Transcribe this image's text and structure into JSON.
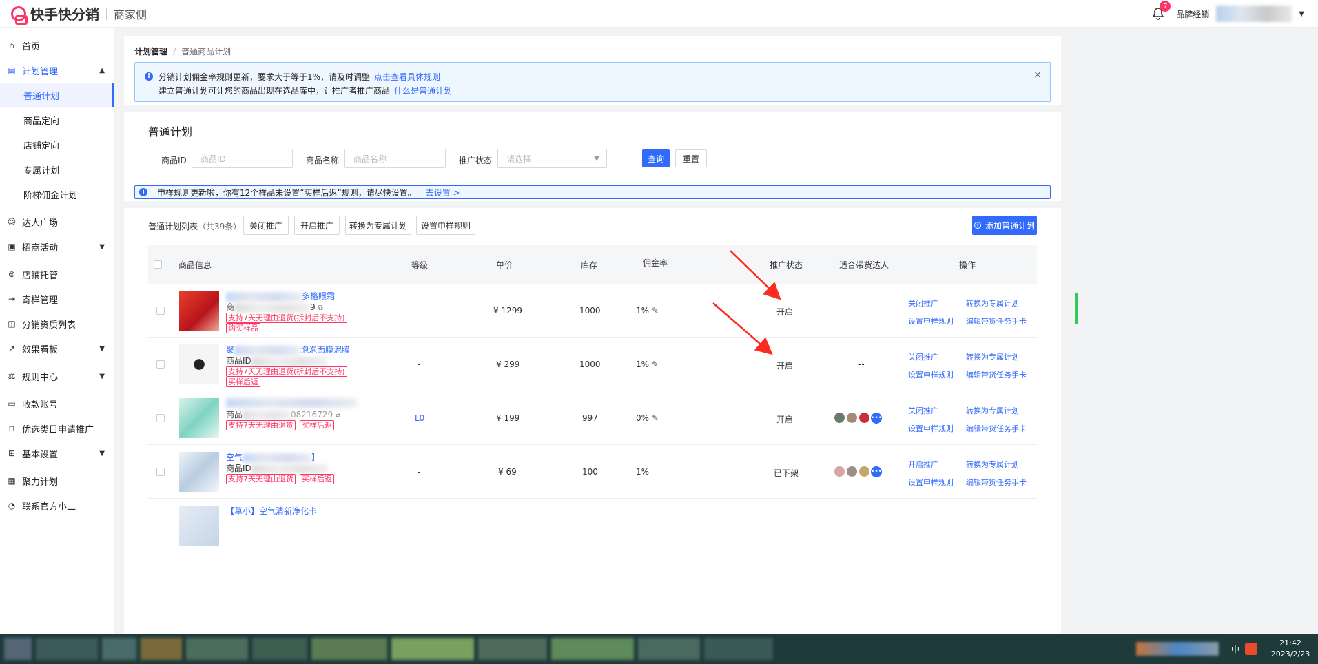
{
  "app": {
    "logo_text": "快手快分销",
    "logo_sub": "商家侧"
  },
  "header": {
    "notification_count": "7",
    "role": "品牌经销"
  },
  "sidebar": {
    "items": [
      {
        "label": "首页",
        "icon": "home-icon"
      },
      {
        "label": "计划管理",
        "icon": "plan-icon",
        "expanded": true,
        "children": [
          {
            "label": "普通计划",
            "active": true
          },
          {
            "label": "商品定向"
          },
          {
            "label": "店铺定向"
          },
          {
            "label": "专属计划"
          },
          {
            "label": "阶梯佣金计划"
          }
        ]
      },
      {
        "label": "达人广场",
        "icon": "person-icon"
      },
      {
        "label": "招商活动",
        "icon": "activity-icon",
        "has_children": true
      },
      {
        "label": "店铺托管",
        "icon": "store-icon"
      },
      {
        "label": "寄样管理",
        "icon": "sample-icon"
      },
      {
        "label": "分销资质列表",
        "icon": "bag-icon"
      },
      {
        "label": "效果看板",
        "icon": "chart-icon",
        "has_children": true
      },
      {
        "label": "规则中心",
        "icon": "rule-icon",
        "has_children": true
      },
      {
        "label": "收款账号",
        "icon": "wallet-icon"
      },
      {
        "label": "优选类目申请推广",
        "icon": "lock-icon"
      },
      {
        "label": "基本设置",
        "icon": "grid-icon",
        "has_children": true
      },
      {
        "label": "聚力计划",
        "icon": "doc-icon"
      },
      {
        "label": "联系官方小二",
        "icon": "chat-icon"
      }
    ]
  },
  "breadcrumb": {
    "root": "计划管理",
    "current": "普通商品计划"
  },
  "notice": {
    "line1": "分销计划佣金率规则更新，要求大于等于1%，请及时调整",
    "line1_link": "点击查看具体规则",
    "line2": "建立普通计划可让您的商品出现在选品库中，让推广者推广商品",
    "line2_link": "什么是普通计划",
    "close": "×"
  },
  "filters": {
    "title": "普通计划",
    "product_id_label": "商品ID",
    "product_id_placeholder": "商品ID",
    "product_name_label": "商品名称",
    "product_name_placeholder": "商品名称",
    "status_label": "推广状态",
    "status_placeholder": "请选择",
    "query_button": "查询",
    "reset_button": "重置"
  },
  "sample_notice": {
    "text": "申样规则更新啦，你有12个样品未设置“买样后返”规则，请尽快设置。",
    "link": "去设置 >"
  },
  "list": {
    "title": "普通计划列表",
    "count": "（共39条）",
    "actions": [
      "关闭推广",
      "开启推广",
      "转换为专属计划",
      "设置申样规则"
    ],
    "add_button": "添加普通计划"
  },
  "table": {
    "headers": {
      "product": "商品信息",
      "level": "等级",
      "price": "单价",
      "stock": "库存",
      "commission": "佣金率",
      "status": "推广状态",
      "talent": "适合带货达人",
      "ops": "操作"
    },
    "rows": [
      {
        "name_suffix": "多格眼霜",
        "id_prefix": "商",
        "id_suffix": "9",
        "tags": [
          "支持7天无理由退货(拆封后不支持)",
          "购买样品"
        ],
        "level": "-",
        "price": "¥ 1299",
        "stock": "1000",
        "commission": "1%",
        "status": "开启",
        "talent": "--",
        "op1": "关闭推广",
        "op2": "转换为专属计划",
        "op3": "设置申样规则",
        "op4": "编辑带货任务手卡"
      },
      {
        "name_prefix": "聚",
        "name_suffix": "泡泡面膜泥膜",
        "id_prefix": "商品ID",
        "id_suffix": "",
        "tags": [
          "支持7天无理由退货(拆封后不支持)",
          "买样后返"
        ],
        "level": "-",
        "price": "¥ 299",
        "stock": "1000",
        "commission": "1%",
        "status": "开启",
        "talent": "--",
        "op1": "关闭推广",
        "op2": "转换为专属计划",
        "op3": "设置申样规则",
        "op4": "编辑带货任务手卡"
      },
      {
        "name_suffix": "",
        "id_prefix": "商品",
        "id_suffix": "08216729",
        "tags": [
          "支持7天无理由退货",
          "买样后返"
        ],
        "level": "L0",
        "price": "¥ 199",
        "stock": "997",
        "commission": "0%",
        "status": "开启",
        "talent": "",
        "op1": "关闭推广",
        "op2": "转换为专属计划",
        "op3": "设置申样规则",
        "op4": "编辑带货任务手卡"
      },
      {
        "name_prefix": "空气",
        "name_suffix": "】",
        "id_prefix": "商品ID",
        "id_suffix": "",
        "tags": [
          "支持7天无理由退货",
          "买样后返"
        ],
        "level": "-",
        "price": "¥ 69",
        "stock": "100",
        "commission": "1%",
        "status": "已下架",
        "talent": "",
        "op1": "开启推广",
        "op2": "转换为专属计划",
        "op3": "设置申样规则",
        "op4": "编辑带货任务手卡"
      },
      {
        "name_partial": "【草小】空气清新净化卡"
      }
    ]
  },
  "taskbar": {
    "ime": "中",
    "time": "21:42",
    "date": "2023/2/23"
  },
  "colors": {
    "primary": "#326bfb",
    "brand": "#fe3666",
    "arrow": "#ff2a1f"
  }
}
